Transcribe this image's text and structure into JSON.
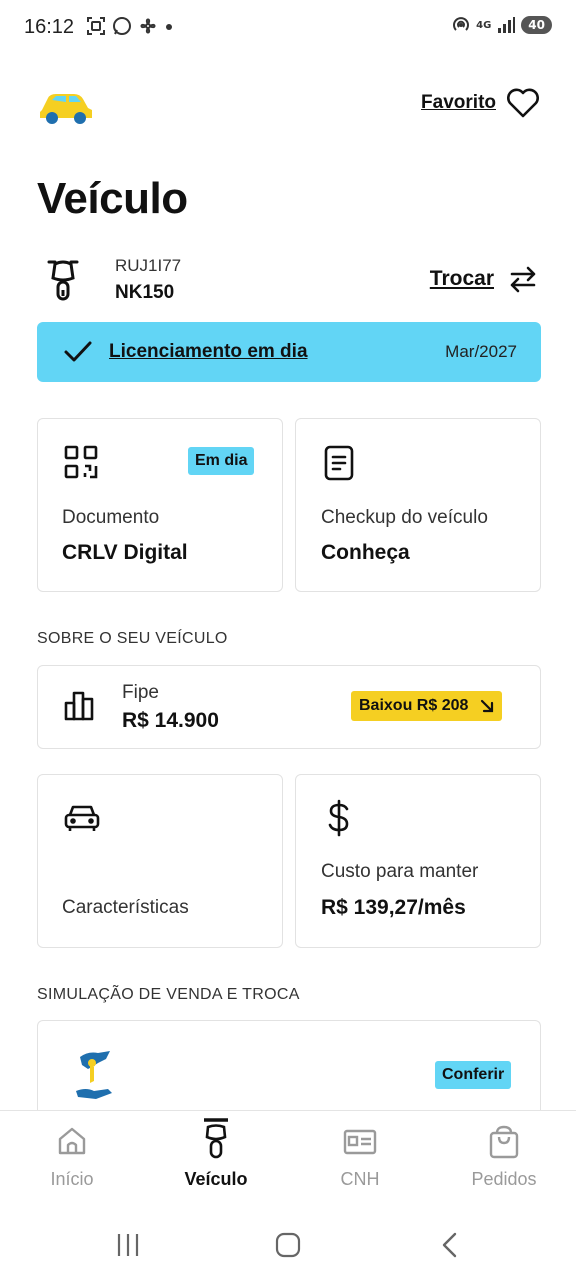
{
  "status_bar": {
    "time": "16:12",
    "battery": "40",
    "network": "4G"
  },
  "header": {
    "favorite_label": "Favorito"
  },
  "page": {
    "title": "Veículo"
  },
  "vehicle": {
    "plate": "RUJ1I77",
    "model": "NK150",
    "switch_label": "Trocar"
  },
  "licensing": {
    "text": "Licenciamento em dia",
    "date": "Mar/2027"
  },
  "cards": {
    "document": {
      "badge": "Em dia",
      "subtitle": "Documento",
      "title": "CRLV Digital"
    },
    "checkup": {
      "subtitle": "Checkup do veículo",
      "title": "Conheça"
    },
    "characteristics": {
      "title": "Características"
    },
    "cost": {
      "subtitle": "Custo para manter",
      "value": "R$ 139,27/mês"
    }
  },
  "about_section": {
    "label": "SOBRE O SEU VEÍCULO"
  },
  "fipe": {
    "label": "Fipe",
    "value": "R$ 14.900",
    "badge": "Baixou R$ 208"
  },
  "simulation_section": {
    "label": "SIMULAÇÃO DE VENDA E TROCA",
    "button": "Conferir"
  },
  "bottom_nav": [
    {
      "label": "Início",
      "icon": "home-icon",
      "active": false
    },
    {
      "label": "Veículo",
      "icon": "motorcycle-icon",
      "active": true
    },
    {
      "label": "CNH",
      "icon": "id-card-icon",
      "active": false
    },
    {
      "label": "Pedidos",
      "icon": "shopping-bag-icon",
      "active": false
    }
  ],
  "colors": {
    "accent_blue": "#62d5f5",
    "accent_yellow": "#f5cf22",
    "text": "#111111",
    "muted": "#9a9a9a"
  }
}
